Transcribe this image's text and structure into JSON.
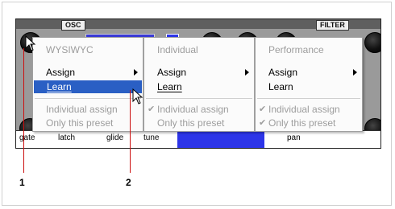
{
  "synth": {
    "osc_tag": "OSC",
    "filter_tag": "FILTER",
    "bottom_labels": [
      "gate",
      "latch",
      "glide",
      "tune",
      "pan"
    ]
  },
  "menus": [
    {
      "title": "WYSIWYC",
      "assign": "Assign",
      "learn": "Learn",
      "individual_assign": "Individual assign",
      "only_this_preset": "Only this preset"
    },
    {
      "title": "Individual",
      "assign": "Assign",
      "learn": "Learn",
      "individual_assign": "Individual assign",
      "only_this_preset": "Only this preset"
    },
    {
      "title": "Performance",
      "assign": "Assign",
      "learn": "Learn",
      "individual_assign": "Individual assign",
      "only_this_preset": "Only this preset"
    }
  ],
  "callouts": [
    "1",
    "2"
  ],
  "colors": {
    "highlight": "#2a5fc4",
    "annotation_line": "#cc1010",
    "disabled_text": "#9d9d9d"
  },
  "icons": [
    "submenu-arrow-icon",
    "check-icon",
    "mouse-pointer-icon"
  ]
}
